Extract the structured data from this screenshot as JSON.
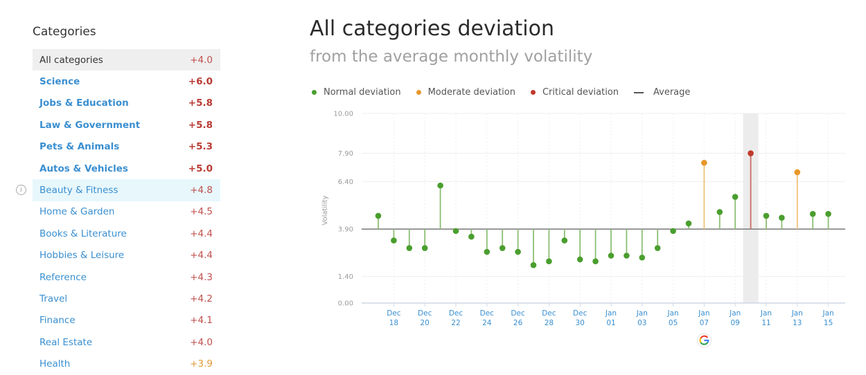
{
  "sidebar": {
    "title": "Categories",
    "categories": [
      {
        "label": "All categories",
        "value": "+4.0",
        "color": "#c0504d",
        "state": "active",
        "bold": false
      },
      {
        "label": "Science",
        "value": "+6.0",
        "color": "#b93a32",
        "state": "",
        "bold": true
      },
      {
        "label": "Jobs & Education",
        "value": "+5.8",
        "color": "#b93a32",
        "state": "",
        "bold": true
      },
      {
        "label": "Law & Government",
        "value": "+5.8",
        "color": "#b93a32",
        "state": "",
        "bold": true
      },
      {
        "label": "Pets & Animals",
        "value": "+5.3",
        "color": "#b93a32",
        "state": "",
        "bold": true
      },
      {
        "label": "Autos & Vehicles",
        "value": "+5.0",
        "color": "#b93a32",
        "state": "",
        "bold": true
      },
      {
        "label": "Beauty & Fitness",
        "value": "+4.8",
        "color": "#c0504d",
        "state": "hover",
        "bold": false
      },
      {
        "label": "Home & Garden",
        "value": "+4.5",
        "color": "#c0504d",
        "state": "",
        "bold": false
      },
      {
        "label": "Books & Literature",
        "value": "+4.4",
        "color": "#c0504d",
        "state": "",
        "bold": false
      },
      {
        "label": "Hobbies & Leisure",
        "value": "+4.4",
        "color": "#c0504d",
        "state": "",
        "bold": false
      },
      {
        "label": "Reference",
        "value": "+4.3",
        "color": "#c0504d",
        "state": "",
        "bold": false
      },
      {
        "label": "Travel",
        "value": "+4.2",
        "color": "#c0504d",
        "state": "",
        "bold": false
      },
      {
        "label": "Finance",
        "value": "+4.1",
        "color": "#c0504d",
        "state": "",
        "bold": false
      },
      {
        "label": "Real Estate",
        "value": "+4.0",
        "color": "#c0504d",
        "state": "",
        "bold": false
      },
      {
        "label": "Health",
        "value": "+3.9",
        "color": "#e09a3a",
        "state": "",
        "bold": false
      }
    ]
  },
  "header": {
    "title": "All categories deviation",
    "subtitle": "from the average monthly volatility"
  },
  "chart_data": {
    "type": "scatter",
    "title": "All categories deviation",
    "subtitle": "from the average monthly volatility",
    "xlabel": "",
    "ylabel": "Volatility",
    "ylim": [
      0,
      10
    ],
    "yticks": [
      "10.00",
      "7.90",
      "6.40",
      "3.90",
      "1.40",
      "0.00"
    ],
    "ytick_values": [
      10.0,
      7.9,
      6.4,
      3.9,
      1.4,
      0.0
    ],
    "average": 3.9,
    "grid": true,
    "legend_position": "top-left",
    "legend": [
      {
        "name": "Normal deviation",
        "color": "#4a9e2f",
        "kind": "dot"
      },
      {
        "name": "Moderate deviation",
        "color": "#e8962a",
        "kind": "dot"
      },
      {
        "name": "Critical deviation",
        "color": "#c0392b",
        "kind": "dot"
      },
      {
        "name": "Average",
        "color": "#555555",
        "kind": "line"
      }
    ],
    "x": [
      "Dec 17",
      "Dec 18",
      "Dec 19",
      "Dec 20",
      "Dec 21",
      "Dec 22",
      "Dec 23",
      "Dec 24",
      "Dec 25",
      "Dec 26",
      "Dec 27",
      "Dec 28",
      "Dec 29",
      "Dec 30",
      "Dec 31",
      "Jan 01",
      "Jan 02",
      "Jan 03",
      "Jan 04",
      "Jan 05",
      "Jan 06",
      "Jan 07",
      "Jan 08",
      "Jan 09",
      "Jan 10",
      "Jan 11",
      "Jan 12",
      "Jan 13",
      "Jan 14",
      "Jan 15"
    ],
    "values": [
      4.6,
      3.3,
      2.9,
      2.9,
      6.2,
      3.8,
      3.5,
      2.7,
      2.9,
      2.7,
      2.0,
      2.2,
      3.3,
      2.3,
      2.2,
      2.5,
      2.5,
      2.4,
      2.9,
      3.8,
      4.2,
      7.4,
      4.8,
      5.6,
      7.9,
      4.6,
      4.5,
      6.9,
      4.7,
      4.7
    ],
    "levels": [
      "normal",
      "normal",
      "normal",
      "normal",
      "normal",
      "normal",
      "normal",
      "normal",
      "normal",
      "normal",
      "normal",
      "normal",
      "normal",
      "normal",
      "normal",
      "normal",
      "normal",
      "normal",
      "normal",
      "normal",
      "normal",
      "moderate",
      "normal",
      "normal",
      "critical",
      "normal",
      "normal",
      "moderate",
      "normal",
      "normal"
    ],
    "xtick_labels": [
      {
        "date": "Dec 18",
        "line1": "Dec",
        "line2": "18"
      },
      {
        "date": "Dec 20",
        "line1": "Dec",
        "line2": "20"
      },
      {
        "date": "Dec 22",
        "line1": "Dec",
        "line2": "22"
      },
      {
        "date": "Dec 24",
        "line1": "Dec",
        "line2": "24"
      },
      {
        "date": "Dec 26",
        "line1": "Dec",
        "line2": "26"
      },
      {
        "date": "Dec 28",
        "line1": "Dec",
        "line2": "28"
      },
      {
        "date": "Dec 30",
        "line1": "Dec",
        "line2": "30"
      },
      {
        "date": "Jan 01",
        "line1": "Jan",
        "line2": "01"
      },
      {
        "date": "Jan 03",
        "line1": "Jan",
        "line2": "03"
      },
      {
        "date": "Jan 05",
        "line1": "Jan",
        "line2": "05"
      },
      {
        "date": "Jan 07",
        "line1": "Jan",
        "line2": "07"
      },
      {
        "date": "Jan 09",
        "line1": "Jan",
        "line2": "09"
      },
      {
        "date": "Jan 11",
        "line1": "Jan",
        "line2": "11"
      },
      {
        "date": "Jan 13",
        "line1": "Jan",
        "line2": "13"
      },
      {
        "date": "Jan 15",
        "line1": "Jan",
        "line2": "15"
      }
    ],
    "highlighted_date": "Jan 10",
    "annotation": {
      "date": "Jan 07",
      "icon": "google-update-icon"
    }
  },
  "colors": {
    "normal": "#4a9e2f",
    "moderate": "#e8962a",
    "critical": "#c0392b",
    "average": "#777777",
    "link": "#3a8fd0"
  }
}
